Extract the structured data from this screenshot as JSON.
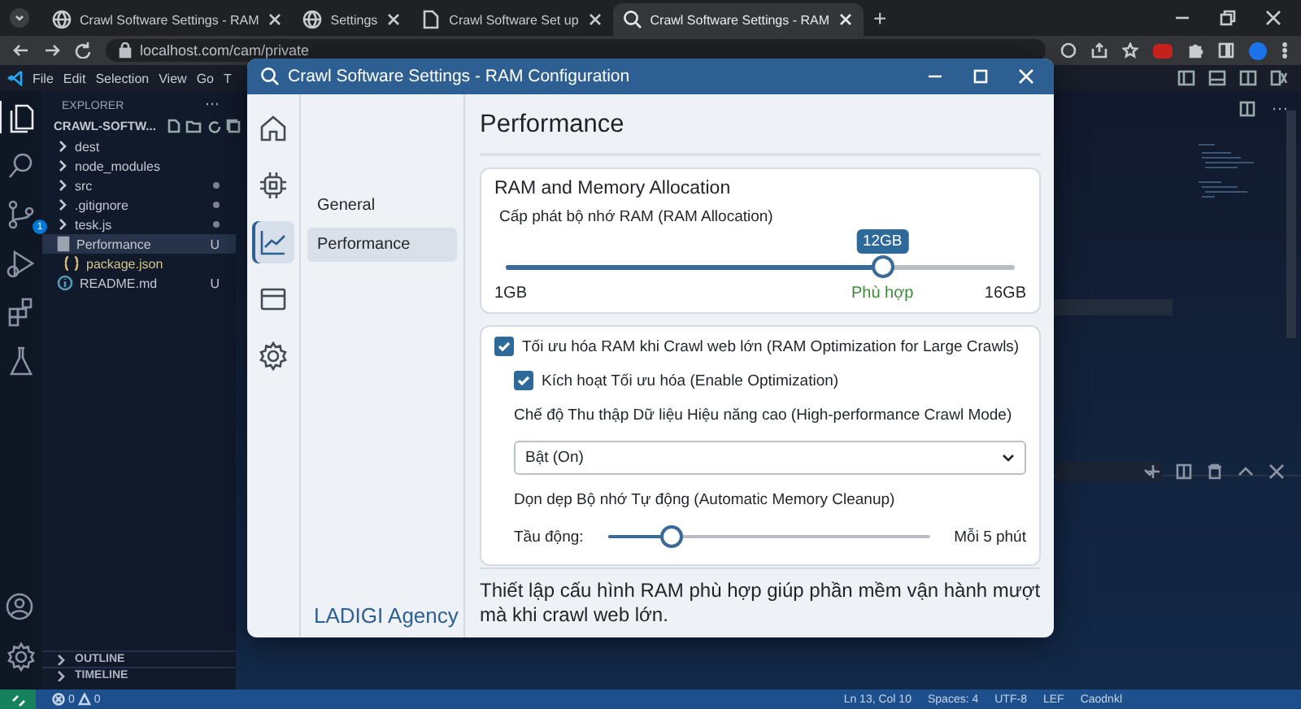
{
  "browser": {
    "tabs": [
      {
        "title": "Crawl Software Settings - RAM",
        "kind": "globe",
        "selected": false
      },
      {
        "title": "Settings",
        "kind": "globe",
        "selected": false
      },
      {
        "title": "Crawl Software Set up",
        "kind": "doc",
        "selected": false
      },
      {
        "title": "Crawl Software Settings - RAM",
        "kind": "search",
        "selected": true
      }
    ],
    "new_tab": "+",
    "address": "localhost.com/cam/private"
  },
  "vscode": {
    "menu": [
      "File",
      "Edit",
      "Selection",
      "View",
      "Go",
      "T"
    ],
    "activity": [
      {
        "kind": "files",
        "selected": true
      },
      {
        "kind": "search",
        "selected": false
      },
      {
        "kind": "branch",
        "selected": false,
        "badge": "1"
      },
      {
        "kind": "run",
        "selected": false
      },
      {
        "kind": "extensions",
        "selected": false
      },
      {
        "kind": "flask",
        "selected": false
      }
    ],
    "explorer": {
      "title": "EXPLORER",
      "folder": "CRAWL-SOFTW...",
      "items": [
        {
          "name": "dest",
          "kind": "folder",
          "dot": false,
          "selected": false
        },
        {
          "name": "node_modules",
          "kind": "folder",
          "dot": false,
          "selected": false
        },
        {
          "name": "src",
          "kind": "folder",
          "dot": true,
          "selected": false
        },
        {
          "name": ".gitignore",
          "kind": "folder",
          "dot": true,
          "selected": false
        },
        {
          "name": "tesk.js",
          "kind": "folder",
          "dot": true,
          "selected": false
        },
        {
          "name": "Performance",
          "kind": "file",
          "badge": "U",
          "dot": false,
          "selected": true
        },
        {
          "name": "package.json",
          "kind": "json",
          "dot": false,
          "selected": false
        },
        {
          "name": "README.md",
          "kind": "info",
          "badge": "U",
          "dot": false,
          "selected": false
        }
      ]
    },
    "panels": [
      {
        "title": "OUTLINE",
        "expanded": false
      },
      {
        "title": "TIMELINE",
        "expanded": false
      }
    ],
    "status_bar": {
      "errors": "0",
      "warnings": "0",
      "items": [
        "Ln 13, Col 10",
        "Spaces: 4",
        "UTF-8",
        "LEF",
        "Caodnkl"
      ]
    }
  },
  "dialog": {
    "title": "Crawl Software Settings - RAM Configuration",
    "rail": [
      {
        "kind": "home",
        "selected": false
      },
      {
        "kind": "chip",
        "selected": false
      },
      {
        "kind": "chart",
        "selected": true
      },
      {
        "kind": "window",
        "selected": false
      },
      {
        "kind": "gear",
        "selected": false
      }
    ],
    "nav": [
      {
        "label": "General",
        "selected": false
      },
      {
        "label": "Performance",
        "selected": true
      }
    ],
    "brand": "LADIGI Agency",
    "heading": "Performance",
    "allocation": {
      "title": "RAM and Memory Allocation",
      "label": "Cấp phát bộ nhớ RAM (RAM Allocation)",
      "value": "12GB",
      "level": 0.74,
      "min": "1GB",
      "hint": "Phù hợp",
      "max": "16GB"
    },
    "optimization": {
      "label": "Tối ưu hóa RAM khi Crawl web lớn (RAM Optimization for Large Crawls)",
      "checked": true,
      "enable": {
        "label": "Kích hoạt Tối ưu hóa (Enable Optimization)",
        "checked": true
      },
      "mode": {
        "label": "Chế độ Thu thập Dữ liệu Hiệu năng cao (High-performance Crawl Mode)",
        "value": "Bật (On)"
      },
      "cleanup": {
        "label": "Dọn dẹp Bộ nhớ Tự động (Automatic Memory Cleanup)",
        "prefix": "Tầu động:",
        "level": 0.2,
        "reading": "Mỗi 5 phút"
      }
    },
    "note": "Thiết lập cấu hình RAM phù hợp giúp phần mềm vận hành mượt mà khi crawl web lớn."
  }
}
